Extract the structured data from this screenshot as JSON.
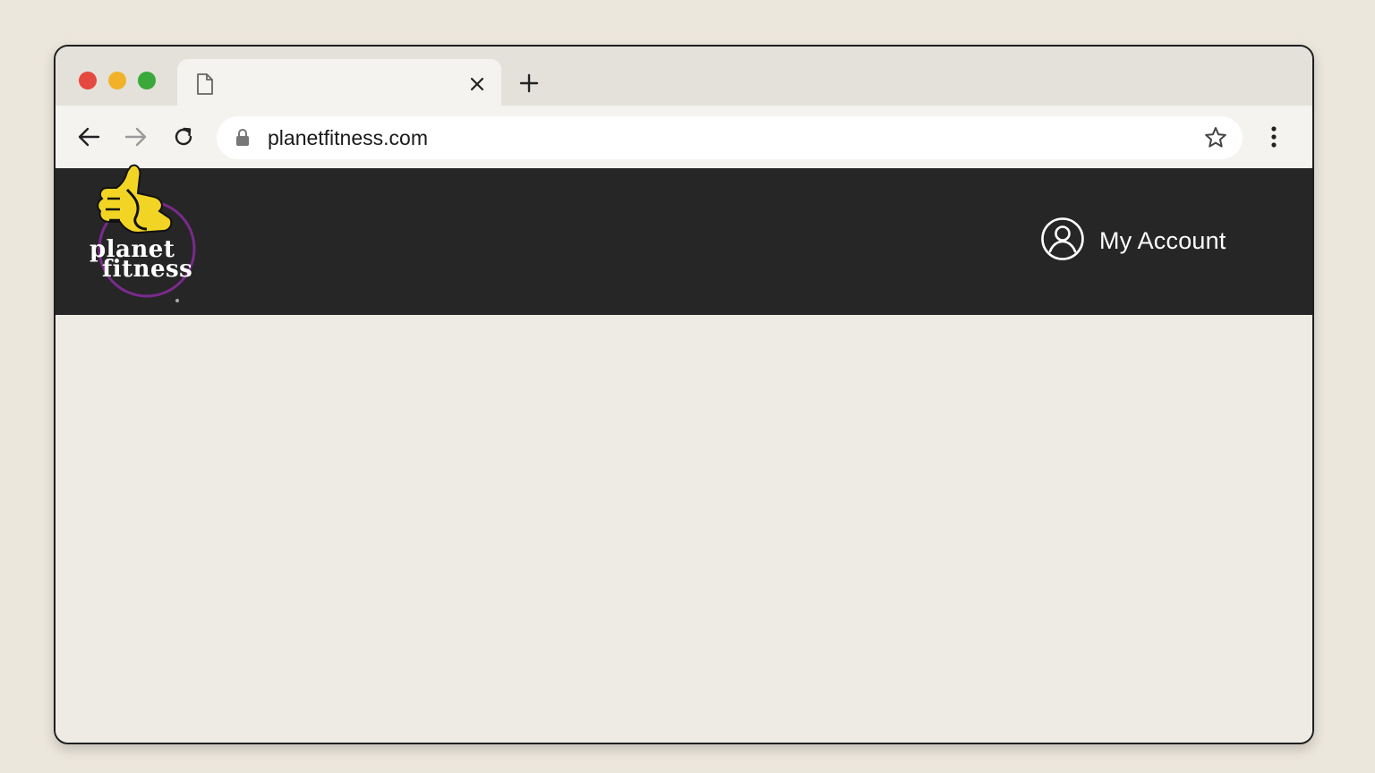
{
  "browser": {
    "tab": {
      "title": "",
      "icon": "document-icon"
    },
    "address_bar": {
      "url": "planetfitness.com",
      "secure": true
    },
    "colors": {
      "close": "#e5483f",
      "minimize": "#f1b22a",
      "maximize": "#3aa83a"
    }
  },
  "site": {
    "logo": {
      "line1": "planet",
      "line2": "fitness"
    },
    "header": {
      "account_label": "My Account",
      "background": "#262626"
    }
  }
}
